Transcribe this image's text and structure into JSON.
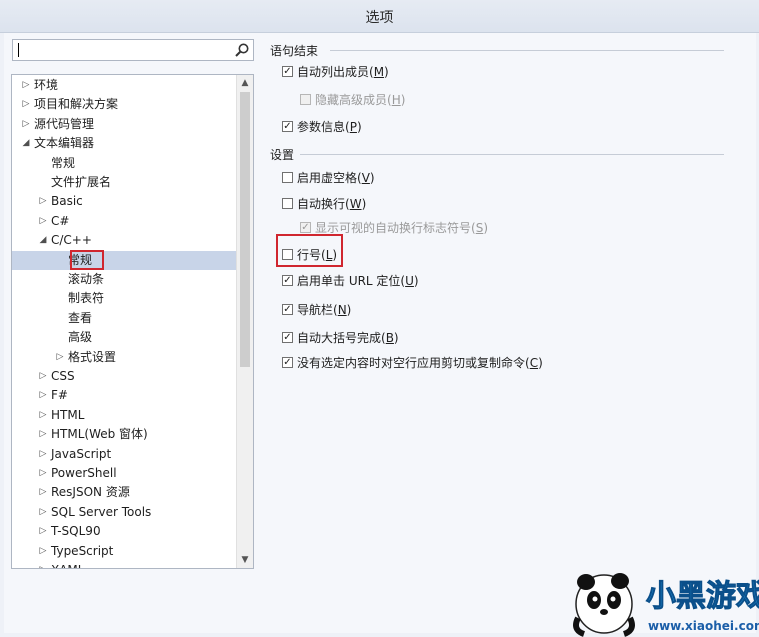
{
  "window": {
    "title": "选项"
  },
  "search": {
    "placeholder": "",
    "icon": "search-icon"
  },
  "tree": {
    "items": [
      {
        "label": "环境",
        "level": 0,
        "expander": "collapsed"
      },
      {
        "label": "项目和解决方案",
        "level": 0,
        "expander": "collapsed"
      },
      {
        "label": "源代码管理",
        "level": 0,
        "expander": "collapsed"
      },
      {
        "label": "文本编辑器",
        "level": 0,
        "expander": "expanded"
      },
      {
        "label": "常规",
        "level": 1,
        "expander": "none"
      },
      {
        "label": "文件扩展名",
        "level": 1,
        "expander": "none"
      },
      {
        "label": "Basic",
        "level": 1,
        "expander": "collapsed"
      },
      {
        "label": "C#",
        "level": 1,
        "expander": "collapsed"
      },
      {
        "label": "C/C++",
        "level": 1,
        "expander": "expanded"
      },
      {
        "label": "常规",
        "level": 2,
        "expander": "none",
        "selected": true
      },
      {
        "label": "滚动条",
        "level": 2,
        "expander": "none"
      },
      {
        "label": "制表符",
        "level": 2,
        "expander": "none"
      },
      {
        "label": "查看",
        "level": 2,
        "expander": "none"
      },
      {
        "label": "高级",
        "level": 2,
        "expander": "none"
      },
      {
        "label": "格式设置",
        "level": 2,
        "expander": "collapsed"
      },
      {
        "label": "CSS",
        "level": 1,
        "expander": "collapsed"
      },
      {
        "label": "F#",
        "level": 1,
        "expander": "collapsed"
      },
      {
        "label": "HTML",
        "level": 1,
        "expander": "collapsed"
      },
      {
        "label": "HTML(Web 窗体)",
        "level": 1,
        "expander": "collapsed"
      },
      {
        "label": "JavaScript",
        "level": 1,
        "expander": "collapsed"
      },
      {
        "label": "PowerShell",
        "level": 1,
        "expander": "collapsed"
      },
      {
        "label": "ResJSON 资源",
        "level": 1,
        "expander": "collapsed"
      },
      {
        "label": "SQL Server Tools",
        "level": 1,
        "expander": "collapsed"
      },
      {
        "label": "T-SQL90",
        "level": 1,
        "expander": "collapsed"
      },
      {
        "label": "TypeScript",
        "level": 1,
        "expander": "collapsed"
      },
      {
        "label": "XAML",
        "level": 1,
        "expander": "collapsed"
      }
    ]
  },
  "statement_completion": {
    "title": "语句结束",
    "options": [
      {
        "pre": "自动列出成员(",
        "key": "M",
        "post": ")",
        "checked": true,
        "disabled": false
      },
      {
        "pre": "隐藏高级成员(",
        "key": "H",
        "post": ")",
        "checked": false,
        "disabled": true
      },
      {
        "pre": "参数信息(",
        "key": "P",
        "post": ")",
        "checked": true,
        "disabled": false
      }
    ]
  },
  "settings": {
    "title": "设置",
    "options": [
      {
        "pre": "启用虚空格(",
        "key": "V",
        "post": ")",
        "checked": false,
        "disabled": false
      },
      {
        "pre": "自动换行(",
        "key": "W",
        "post": ")",
        "checked": false,
        "disabled": false
      },
      {
        "pre": "显示可视的自动换行标志符号(",
        "key": "S",
        "post": ")",
        "checked": true,
        "disabled": true
      },
      {
        "pre": "行号(",
        "key": "L",
        "post": ")",
        "checked": false,
        "disabled": false
      },
      {
        "pre": "启用单击 URL 定位(",
        "key": "U",
        "post": ")",
        "checked": true,
        "disabled": false
      },
      {
        "pre": "导航栏(",
        "key": "N",
        "post": ")",
        "checked": true,
        "disabled": false
      },
      {
        "pre": "自动大括号完成(",
        "key": "B",
        "post": ")",
        "checked": true,
        "disabled": false
      },
      {
        "pre": "没有选定内容时对空行应用剪切或复制命令(",
        "key": "C",
        "post": ")",
        "checked": true,
        "disabled": false
      }
    ]
  },
  "watermark": {
    "text": "小黑游戏",
    "url": "www.xiaohei.com"
  },
  "colors": {
    "highlight_red": "#d0262f",
    "selection": "#c8d4e8"
  }
}
